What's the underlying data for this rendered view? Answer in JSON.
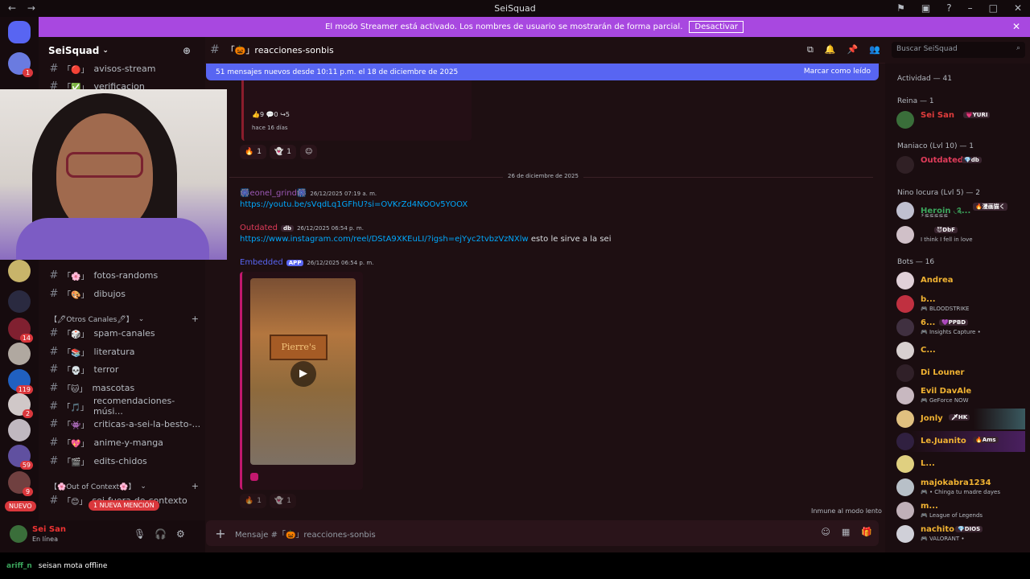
{
  "window": {
    "title": "SeiSquad"
  },
  "banner": {
    "text": "El modo Streamer está activado. Los nombres de usuario se mostrarán de forma parcial.",
    "button": "Desactivar"
  },
  "server": {
    "name": "SeiSquad"
  },
  "channels_top": [
    "avisos-stream",
    "verificacion"
  ],
  "channels": [
    {
      "emoji": "「🌸」",
      "name": "fotos-randoms"
    },
    {
      "emoji": "「🎨」",
      "name": "dibujos"
    }
  ],
  "category_otros": "【🖊Otros Canales🖊】",
  "channels_otros": [
    {
      "emoji": "「🎲」",
      "name": "spam-canales"
    },
    {
      "emoji": "「📚」",
      "name": "literatura"
    },
    {
      "emoji": "「💀」",
      "name": "terror"
    },
    {
      "emoji": "「🐱」",
      "name": "mascotas"
    },
    {
      "emoji": "「🎵」",
      "name": "recomendaciones-músi..."
    },
    {
      "emoji": "「👾」",
      "name": "criticas-a-sei-la-besto-..."
    },
    {
      "emoji": "「💖」",
      "name": "anime-y-manga"
    },
    {
      "emoji": "「🎬」",
      "name": "edits-chidos"
    }
  ],
  "category_ooc": "【🌸Out of Context🌸】",
  "channels_ooc": [
    {
      "emoji": "「😊」",
      "name": "sei-fuera-de-contexto"
    }
  ],
  "guild_badges": [
    "1",
    "14",
    "119",
    "2",
    "59",
    "9"
  ],
  "labels": {
    "nuevo": "NUEVO",
    "mention": "1 NUEVA MENCIÓN"
  },
  "user": {
    "name": "Sei San",
    "status": "En línea"
  },
  "chat": {
    "channel": "「🎃」reacciones-sonbis",
    "search_placeholder": "Buscar SeiSquad",
    "new_messages": "51 mensajes nuevos desde 10:11 p.m. el 18 de diciembre de 2025",
    "mark_read": "Marcar como leído",
    "embed_stats": "👍9  💬0  ↪5",
    "embed_when": "hace 16 días",
    "reactions": [
      {
        "emoji": "🔥",
        "count": "1"
      },
      {
        "emoji": "👻",
        "count": "1"
      }
    ],
    "date_divider": "26 de diciembre de 2025",
    "messages": [
      {
        "author": "🎆eonel_grind🎆",
        "time": "26/12/2025 07:19 a. m.",
        "text": "https://youtu.be/sVqdLq1GFhU?si=OVKrZd4NOOv5YOOX",
        "color": "#9b59b6"
      },
      {
        "author": "Outdated",
        "tag": "db",
        "time": "26/12/2025 06:54 p. m.",
        "link": "https://www.instagram.com/reel/DStA9XKEuLI/?igsh=ejYyc2tvbzVzNXlw",
        "text": " esto le sirve a la sei",
        "color": "#e03c5a"
      },
      {
        "author": "Embedded",
        "tag": "APP",
        "time": "26/12/2025 06:54 p. m.",
        "color": "#5865f2"
      }
    ],
    "video_sign": "Pierre's",
    "composer_placeholder": "Mensaje #「🎃」reacciones-sonbis",
    "immune": "Inmune al modo lento"
  },
  "members": {
    "header": "Actividad — 41",
    "groups": [
      {
        "title": "Reina — 1",
        "items": [
          {
            "name": "Sei San",
            "tag": "💗YURI",
            "color": "#e03c3c"
          }
        ]
      },
      {
        "title": "Maniaco (Lvl 10) — 1",
        "items": [
          {
            "name": "Outdated",
            "tag": "💎db",
            "color": "#e03c5a"
          }
        ]
      },
      {
        "title": "Nino locura (Lvl 5) — 2",
        "items": [
          {
            "name": "Heroin ◟༉...",
            "tag": "🔥漫画猫く",
            "sub": "⚡≤≤≤≤≤",
            "color": "#3ba55c"
          },
          {
            "name": "",
            "tag": "😈DbF",
            "sub": "I think I fell in love",
            "color": "#e03c5a"
          }
        ]
      },
      {
        "title": "Bots — 16",
        "items": [
          {
            "name": "Andrea",
            "color": "#f0b232"
          },
          {
            "name": "b...",
            "sub": "🎮 BLOODSTRIKE",
            "color": "#f0b232"
          },
          {
            "name": "6...",
            "tag": "💜PPBD",
            "sub": "🎮 Insights Capture •",
            "color": "#f0b232"
          },
          {
            "name": "C...",
            "color": "#f0b232"
          },
          {
            "name": "Di Louner",
            "color": "#f0b232"
          },
          {
            "name": "Evil DavAle",
            "sub": "🎮 GeForce NOW",
            "color": "#f0b232"
          },
          {
            "name": "Jonly",
            "tag": "🗡HK",
            "color": "#f0b232"
          },
          {
            "name": "Le.Juanito",
            "tag": "🔥Ams",
            "color": "#f0b232"
          },
          {
            "name": "L...",
            "color": "#f0b232"
          },
          {
            "name": "majokabra1234",
            "sub": "🎮 • Chinga tu madre dayes",
            "color": "#f0b232"
          },
          {
            "name": "m...",
            "sub": "🎮 League of Legends",
            "color": "#f0b232"
          },
          {
            "name": "nachito",
            "tag": "💎DIOS",
            "sub": "🎮 VALORANT •",
            "color": "#f0b232"
          }
        ]
      }
    ]
  },
  "stream_chat": {
    "user": "ariff_n",
    "text": "seisan mota offline"
  }
}
